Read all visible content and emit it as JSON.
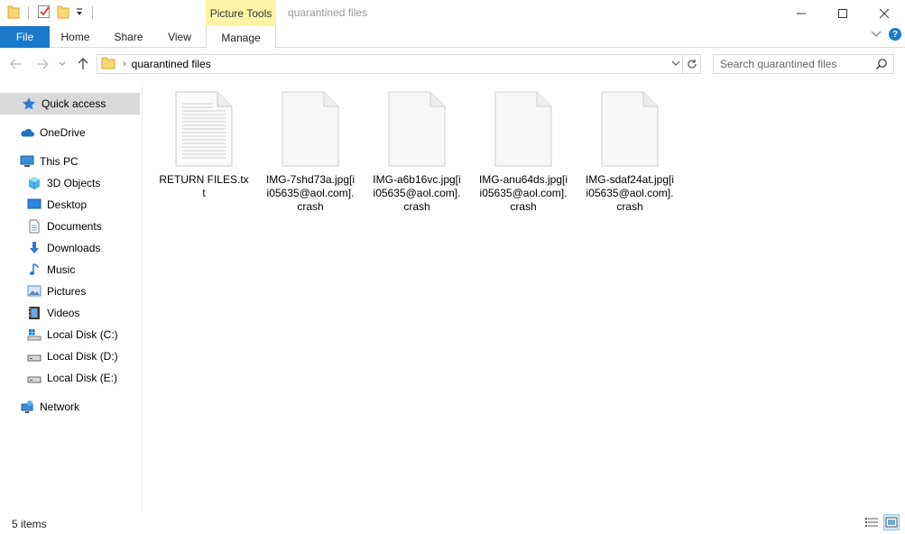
{
  "window": {
    "title": "quarantined files",
    "context_tab": "Picture Tools"
  },
  "ribbon": {
    "tabs": [
      {
        "label": "File"
      },
      {
        "label": "Home"
      },
      {
        "label": "Share"
      },
      {
        "label": "View"
      },
      {
        "label": "Manage"
      }
    ]
  },
  "address": {
    "path": "quarantined files"
  },
  "search": {
    "placeholder": "Search quarantined files"
  },
  "sidebar": {
    "items": [
      {
        "label": "Quick access",
        "icon": "star-icon"
      },
      {
        "label": "OneDrive",
        "icon": "cloud-icon"
      },
      {
        "label": "This PC",
        "icon": "computer-icon"
      },
      {
        "label": "3D Objects",
        "icon": "cube-icon"
      },
      {
        "label": "Desktop",
        "icon": "desktop-icon"
      },
      {
        "label": "Documents",
        "icon": "document-icon"
      },
      {
        "label": "Downloads",
        "icon": "download-icon"
      },
      {
        "label": "Music",
        "icon": "music-icon"
      },
      {
        "label": "Pictures",
        "icon": "picture-icon"
      },
      {
        "label": "Videos",
        "icon": "video-icon"
      },
      {
        "label": "Local Disk (C:)",
        "icon": "drive-icon"
      },
      {
        "label": "Local Disk (D:)",
        "icon": "drive-icon"
      },
      {
        "label": "Local Disk (E:)",
        "icon": "drive-icon"
      },
      {
        "label": "Network",
        "icon": "network-icon"
      }
    ]
  },
  "files": [
    {
      "name": "RETURN FILES.txt",
      "type": "text"
    },
    {
      "name": "IMG-7shd73a.jpg[ii05635@aol.com].crash",
      "type": "blank"
    },
    {
      "name": "IMG-a6b16vc.jpg[ii05635@aol.com].crash",
      "type": "blank"
    },
    {
      "name": "IMG-anu64ds.jpg[ii05635@aol.com].crash",
      "type": "blank"
    },
    {
      "name": "IMG-sdaf24at.jpg[ii05635@aol.com].crash",
      "type": "blank"
    }
  ],
  "status": {
    "count": "5 items"
  },
  "colors": {
    "accent": "#1979ca",
    "context_tab": "#fdf4a7",
    "selected": "#d9d9d9"
  }
}
